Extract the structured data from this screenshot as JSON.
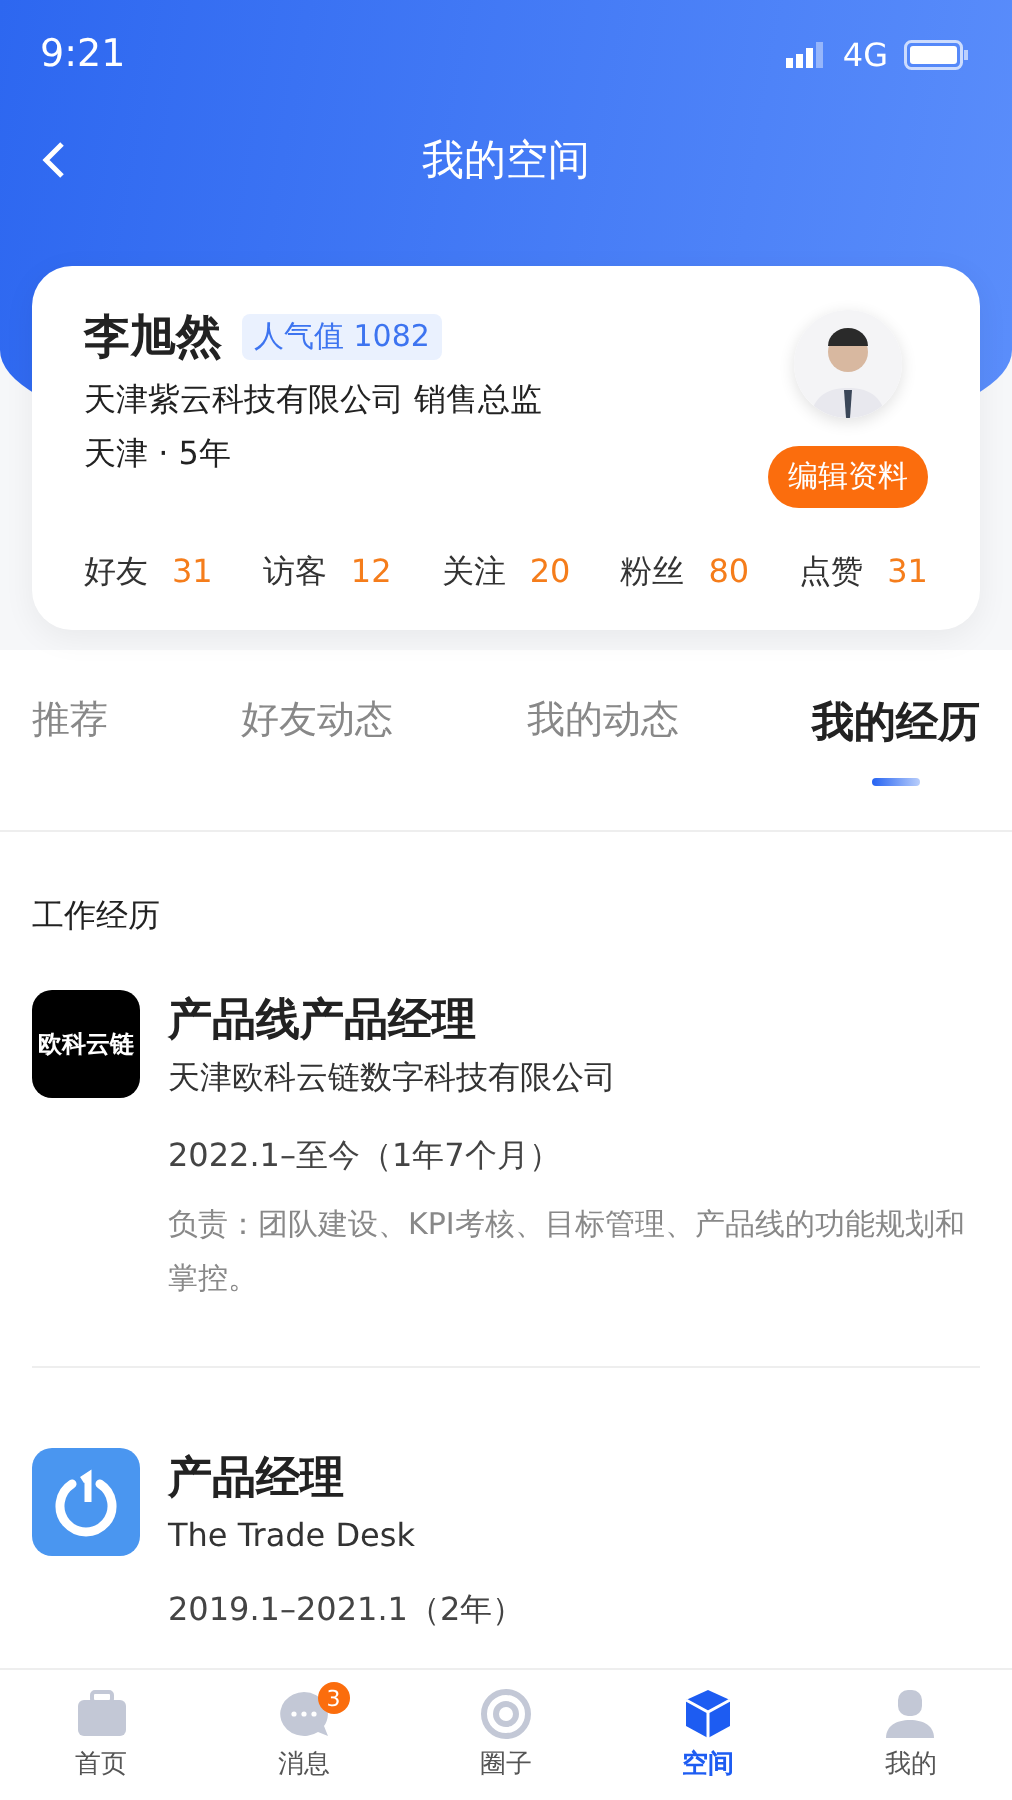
{
  "status_bar": {
    "time": "9:21",
    "network": "4G"
  },
  "nav": {
    "title": "我的空间"
  },
  "profile": {
    "name": "李旭然",
    "popularity": "人气值 1082",
    "company_title": "天津紫云科技有限公司 销售总监",
    "location_years": "天津 · 5年",
    "edit_button": "编辑资料",
    "stats": [
      {
        "label": "好友",
        "value": "31"
      },
      {
        "label": "访客",
        "value": "12"
      },
      {
        "label": "关注",
        "value": "20"
      },
      {
        "label": "粉丝",
        "value": "80"
      },
      {
        "label": "点赞",
        "value": "31"
      }
    ]
  },
  "tabs": [
    {
      "label": "推荐",
      "selected": false
    },
    {
      "label": "好友动态",
      "selected": false
    },
    {
      "label": "我的动态",
      "selected": false
    },
    {
      "label": "我的经历",
      "selected": true
    }
  ],
  "section_title": "工作经历",
  "jobs": [
    {
      "kind": "text",
      "logo_text": "欧科云链",
      "title": "产品线产品经理",
      "company": "天津欧科云链数字科技有限公司",
      "period": "2022.1–至今（1年7个月）",
      "description": "负责：团队建设、KPI考核、目标管理、产品线的功能规划和掌控。"
    },
    {
      "kind": "power",
      "title": "产品经理",
      "company": "The Trade Desk",
      "period": "2019.1–2021.1（2年）"
    }
  ],
  "bottom_nav": [
    {
      "label": "首页",
      "kind": "briefcase",
      "selected": false
    },
    {
      "label": "消息",
      "kind": "chat",
      "selected": false,
      "badge": "3"
    },
    {
      "label": "圈子",
      "kind": "circle",
      "selected": false
    },
    {
      "label": "空间",
      "kind": "cube",
      "selected": true
    },
    {
      "label": "我的",
      "kind": "person",
      "selected": false
    }
  ]
}
